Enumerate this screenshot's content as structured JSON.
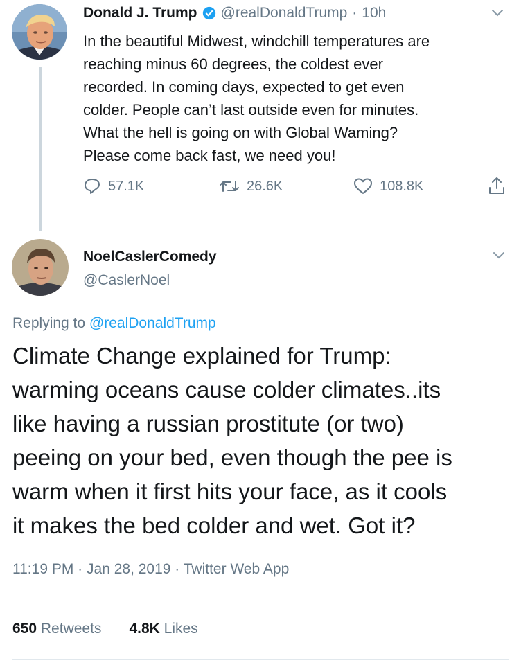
{
  "tweet": {
    "author_name": "Donald J. Trump",
    "verified_icon": "verified-badge-icon",
    "author_handle": "@realDonaldTrump",
    "separator": "·",
    "time_ago": "10h",
    "text_lines": [
      "In the beautiful Midwest, windchill temperatures are",
      "reaching minus 60 degrees, the coldest ever",
      "recorded. In coming days, expected to get even",
      "colder. People can’t last outside even for minutes.",
      "What the hell is going on with Global Waming?",
      "Please come back fast, we need you!"
    ],
    "replies": "57.1K",
    "retweets": "26.6K",
    "likes": "108.8K"
  },
  "reply": {
    "author_name": "NoelCaslerComedy",
    "author_handle": "@CaslerNoel",
    "replying_label": "Replying to",
    "replying_to": "@realDonaldTrump",
    "text_lines": [
      "Climate Change explained for Trump:",
      "warming oceans cause colder climates..its",
      "like having a russian prostitute (or two)",
      "peeing on your bed, even though the pee is",
      "warm when it first hits your face, as it cools",
      "it makes the bed colder and wet. Got it?"
    ],
    "time": "11:19 PM",
    "date": "Jan 28, 2019",
    "source": "Twitter Web App",
    "retweet_count": "650",
    "retweet_label": "Retweets",
    "like_count": "4.8K",
    "like_label": "Likes"
  },
  "colors": {
    "text": "#14171a",
    "secondary": "#657786",
    "link": "#1da1f2",
    "verified": "#1da1f2",
    "divider": "#e1e8ed"
  }
}
